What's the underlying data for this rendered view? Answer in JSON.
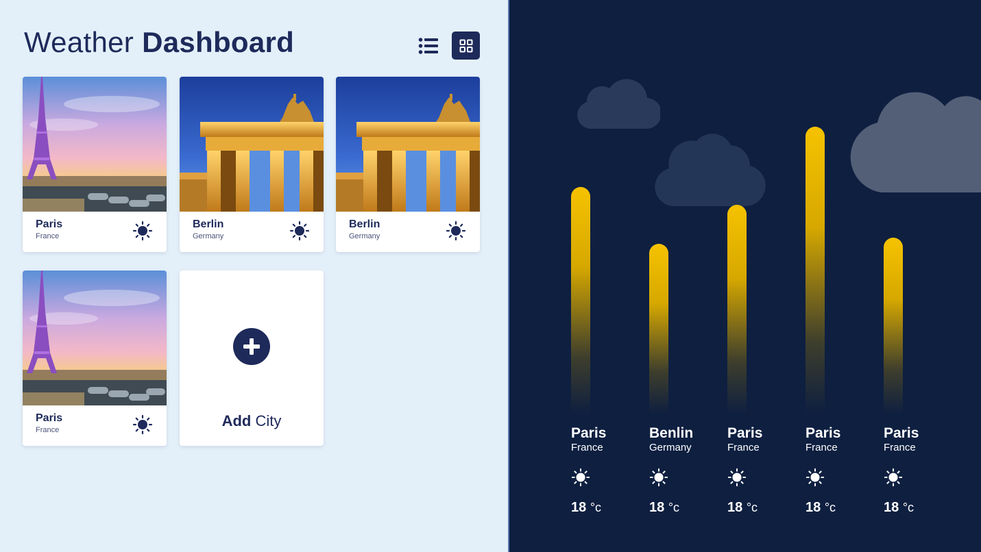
{
  "header": {
    "title_light": "Weather",
    "title_bold": "Dashboard",
    "list_view_icon": "list-icon",
    "grid_view_icon": "grid-icon"
  },
  "cards": [
    {
      "city": "Paris",
      "country": "France",
      "photo": "eiffel-tower-photo",
      "icon": "sun-icon"
    },
    {
      "city": "Berlin",
      "country": "Germany",
      "photo": "brandenburg-gate-photo",
      "icon": "sun-icon"
    },
    {
      "city": "Berlin",
      "country": "Germany",
      "photo": "brandenburg-gate-photo",
      "icon": "sun-icon"
    },
    {
      "city": "Paris",
      "country": "France",
      "photo": "eiffel-tower-photo",
      "icon": "sun-icon"
    }
  ],
  "add_card": {
    "label_bold": "Add",
    "label_light": "City",
    "icon": "plus-icon"
  },
  "forecast": [
    {
      "city": "Paris",
      "country": "France",
      "temp": "18",
      "unit": "°c",
      "level": 0.76
    },
    {
      "city": "Benlin",
      "country": "Germany",
      "temp": "18",
      "unit": "°c",
      "level": 0.57
    },
    {
      "city": "Paris",
      "country": "France",
      "temp": "18",
      "unit": "°c",
      "level": 0.7
    },
    {
      "city": "Paris",
      "country": "France",
      "temp": "18",
      "unit": "°c",
      "level": 0.96
    },
    {
      "city": "Paris",
      "country": "France",
      "temp": "18",
      "unit": "°c",
      "level": 0.59
    }
  ],
  "colors": {
    "navy": "#1e2a5a",
    "panel_bg": "#0e1f40",
    "accent_yellow": "#f6c200",
    "left_bg": "#e4f0f9"
  }
}
